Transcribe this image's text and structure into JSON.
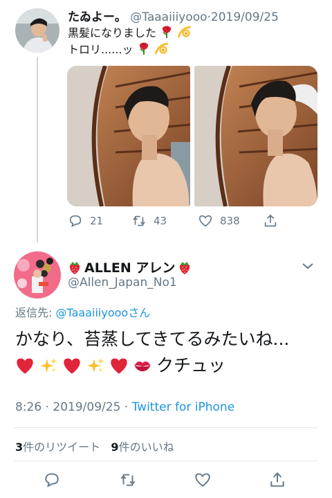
{
  "parent_tweet": {
    "display_name": "たゐよー。",
    "handle": "@Taaaiiiyooo",
    "separator": "·",
    "date": "2019/09/25",
    "text_line1": "黒髪になりました",
    "text_line2": "トロリ......ッ",
    "line_emojis": [
      "rose",
      "dizzy"
    ],
    "photo_count": 2,
    "actions": {
      "reply_count": "21",
      "retweet_count": "43",
      "like_count": "838"
    }
  },
  "main_tweet": {
    "display_name": "ALLEN アレン",
    "name_emoji": "strawberry",
    "handle": "@Allen_Japan_No1",
    "reply_prefix": "返信先: ",
    "reply_to_handle": "@Taaaiiiyooo",
    "reply_suffix": "さん",
    "text_line1": "かなり、苔蒸してきてるみたいね...",
    "text_line2_suffix": "クチュッ",
    "text_line2_emojis": [
      "red-heart",
      "sparkles",
      "red-heart",
      "sparkles",
      "red-heart",
      "kiss-mark"
    ],
    "time": "8:26",
    "date": "2019/09/25",
    "meta_separator": "·",
    "source": "Twitter for iPhone",
    "retweet_count": "3",
    "retweet_label": "件のリツイート",
    "like_count": "9",
    "like_label": "件のいいね"
  },
  "colors": {
    "accent": "#1b95e0",
    "muted": "#657786",
    "divider": "#e1e8ed",
    "heart": "#e0245e"
  }
}
